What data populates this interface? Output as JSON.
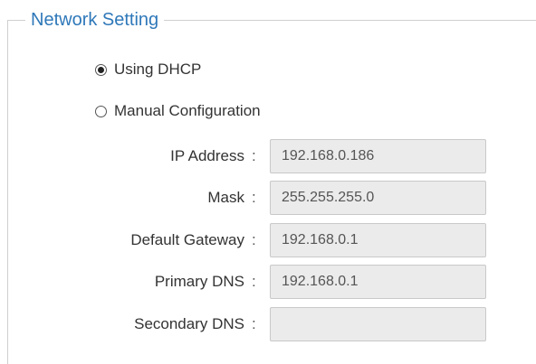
{
  "section": {
    "title": "Network Setting"
  },
  "mode": {
    "options": [
      {
        "label": "Using DHCP",
        "selected": true
      },
      {
        "label": "Manual Configuration",
        "selected": false
      }
    ]
  },
  "fields": {
    "ip_address": {
      "label": "IP Address",
      "value": "192.168.0.186"
    },
    "mask": {
      "label": "Mask",
      "value": "255.255.255.0"
    },
    "default_gateway": {
      "label": "Default Gateway",
      "value": "192.168.0.1"
    },
    "primary_dns": {
      "label": "Primary DNS",
      "value": "192.168.0.1"
    },
    "secondary_dns": {
      "label": "Secondary DNS",
      "value": ""
    }
  },
  "separator": ":",
  "colors": {
    "legend": "#2e78b9",
    "input_bg": "#ebebeb",
    "input_border": "#c9c9c9"
  }
}
